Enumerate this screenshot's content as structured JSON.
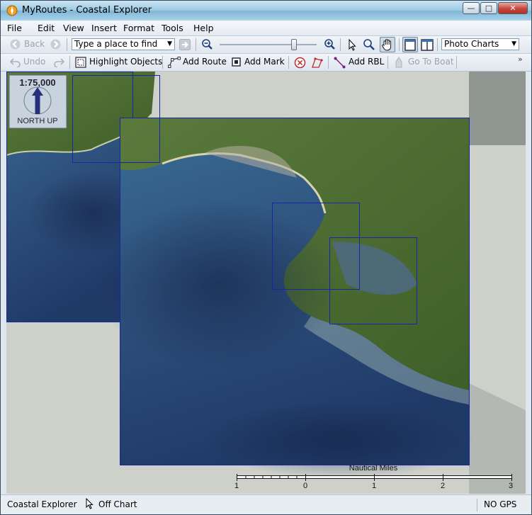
{
  "window": {
    "title": "MyRoutes - Coastal Explorer",
    "btn_minimize": "—",
    "btn_maximize": "□",
    "btn_close": "✕"
  },
  "menu": [
    "File",
    "Edit",
    "View",
    "Insert",
    "Format",
    "Tools",
    "Help"
  ],
  "toolbar1": {
    "back_label": "Back",
    "search_placeholder": "Type a place to find",
    "chart_type": "Photo Charts",
    "zoom_level": 0.76
  },
  "toolbar2": {
    "undo_label": "Undo",
    "highlight_label": "Highlight Objects",
    "add_route_label": "Add Route",
    "add_mark_label": "Add Mark",
    "add_rbl_label": "Add RBL",
    "go_to_boat_label": "Go To Boat",
    "overflow": "»"
  },
  "chart": {
    "scale": "1:75,000",
    "orientation": "NORTH UP",
    "scalebar_title": "Nautical Miles",
    "scalebar_ticks": [
      "1",
      "0",
      "1",
      "2",
      "3"
    ]
  },
  "statusbar": {
    "app": "Coastal Explorer",
    "position": "Off Chart",
    "gps": "NO GPS"
  },
  "icons": [
    "app-icon",
    "back-icon",
    "forward-icon",
    "go-icon",
    "zoom-out-icon",
    "zoom-in-icon",
    "select-icon",
    "zoom-tool-icon",
    "pan-hand-icon",
    "single-pane-icon",
    "split-pane-icon",
    "undo-icon",
    "redo-icon",
    "highlight-icon",
    "route-icon",
    "mark-icon",
    "delete-icon",
    "edit-route-icon",
    "rbl-icon",
    "boat-icon",
    "north-arrow-icon",
    "cursor-icon"
  ]
}
